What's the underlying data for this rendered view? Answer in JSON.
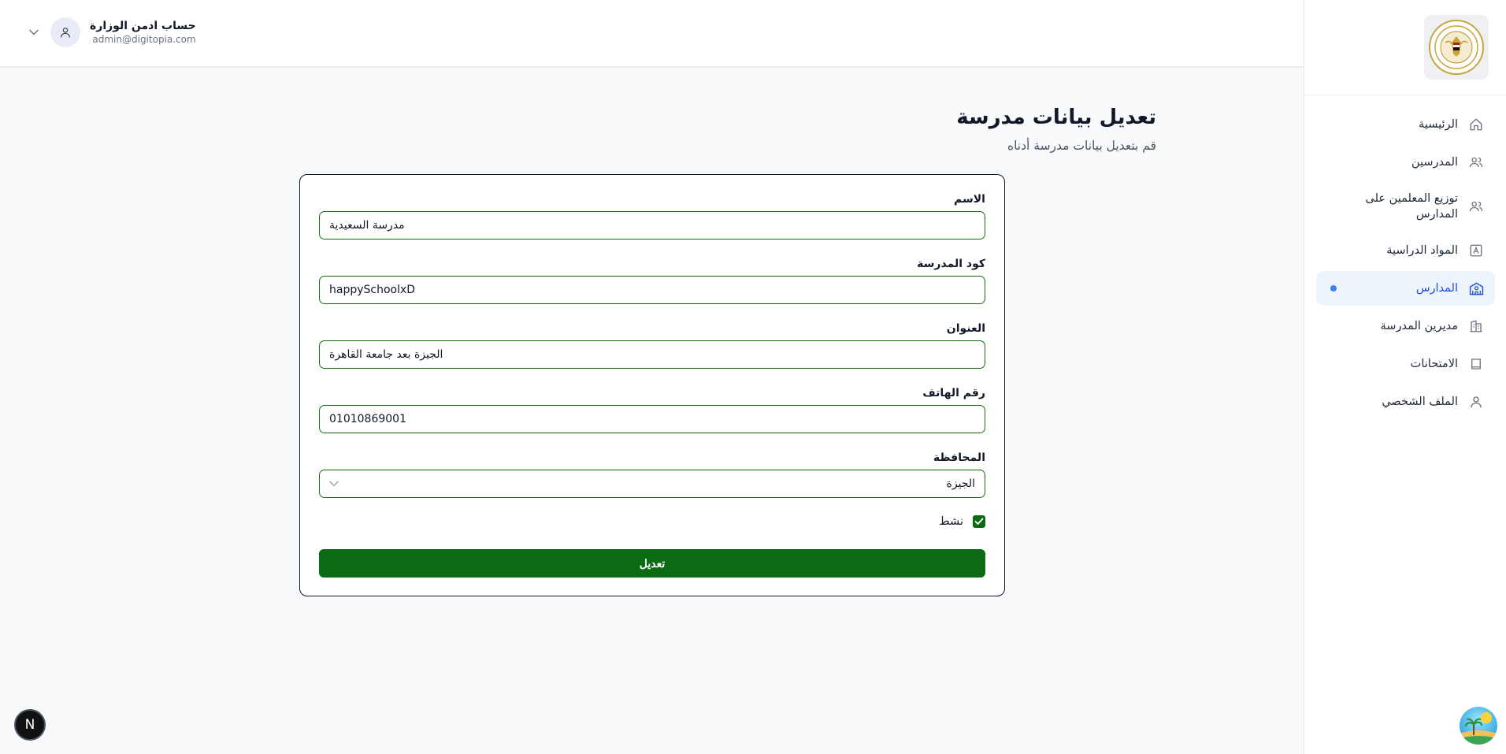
{
  "header": {
    "account_name": "حساب ادمن الوزارة",
    "account_email": "admin@digitopia.com"
  },
  "sidebar": {
    "items": [
      {
        "label": "الرئيسية",
        "icon": "home-icon"
      },
      {
        "label": "المدرسين",
        "icon": "users-icon"
      },
      {
        "label": "توزيع المعلمين على المدارس",
        "icon": "users-icon"
      },
      {
        "label": "المواد الدراسية",
        "icon": "subject-icon"
      },
      {
        "label": "المدارس",
        "icon": "school-icon",
        "active": true
      },
      {
        "label": "مديرين المدرسة",
        "icon": "building-icon"
      },
      {
        "label": "الامتحانات",
        "icon": "book-icon"
      },
      {
        "label": "الملف الشخصي",
        "icon": "user-icon"
      }
    ]
  },
  "page": {
    "title": "تعديل بيانات مدرسة",
    "subtitle": "قم بتعديل بيانات مدرسة أدناه"
  },
  "form": {
    "name_label": "الاسم",
    "name_value": "مدرسة السعيدية",
    "code_label": "كود المدرسة",
    "code_value": "happySchoolxD",
    "address_label": "العنوان",
    "address_value": "الجيزة بعد جامعة القاهرة",
    "phone_label": "رقم الهاتف",
    "phone_value": "01010869001",
    "governorate_label": "المحافظة",
    "governorate_value": "الجيزة",
    "active_label": "نشط",
    "active_checked": true,
    "submit_label": "تعديل"
  },
  "badge": {
    "letter": "N"
  },
  "colors": {
    "primary_green": "#0b6b14",
    "field_border": "#166d16",
    "active_blue": "#1d4ed8",
    "active_bg": "#eef4fb"
  }
}
